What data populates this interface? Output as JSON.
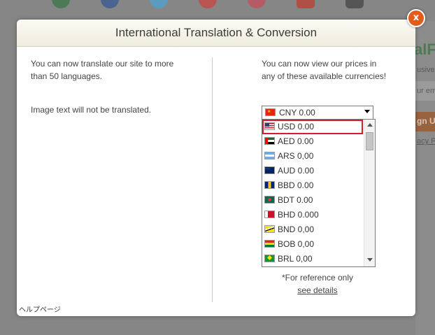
{
  "modal": {
    "title": "International Translation & Conversion",
    "close_label": "x",
    "left_text_1": "You can now translate our site to more than 50 languages.",
    "left_text_2": "Image text will not be translated.",
    "right_text": "You can now view our prices in any of these available currencies!",
    "footer_link": "ヘルプページ",
    "reference_note": "*For reference only",
    "see_details": "see details"
  },
  "currency_select": {
    "selected": "CNY 0.00",
    "selected_flag": "china-flag-icon",
    "options": [
      {
        "label": "USD 0.00",
        "flag": "usa-flag-icon",
        "highlighted": true
      },
      {
        "label": "AED 0.00",
        "flag": "uae-flag-icon"
      },
      {
        "label": "ARS 0,00",
        "flag": "argentina-flag-icon"
      },
      {
        "label": "AUD 0.00",
        "flag": "australia-flag-icon"
      },
      {
        "label": "BBD 0.00",
        "flag": "barbados-flag-icon"
      },
      {
        "label": "BDT 0.00",
        "flag": "bangladesh-flag-icon"
      },
      {
        "label": "BHD 0.000",
        "flag": "bahrain-flag-icon"
      },
      {
        "label": "BND 0,00",
        "flag": "brunei-flag-icon"
      },
      {
        "label": "BOB 0,00",
        "flag": "bolivia-flag-icon"
      },
      {
        "label": "BRL 0,00",
        "flag": "brazil-flag-icon"
      }
    ]
  },
  "background": {
    "brand_fragment": "alF",
    "exclusive_fragment": "usive",
    "email_placeholder_fragment": "ur em",
    "signup_fragment": "gn Up",
    "privacy_fragment": "acy P",
    "social_icons": [
      "instagram-icon",
      "facebook-icon",
      "twitter-icon",
      "googleplus-icon",
      "pinterest-icon",
      "youtube-icon",
      "email-icon"
    ]
  },
  "colors": {
    "close_button": "#e35a1d",
    "highlight_outline": "#d1202a",
    "modal_header": "#f3f1e6",
    "overlay": "#868686"
  }
}
